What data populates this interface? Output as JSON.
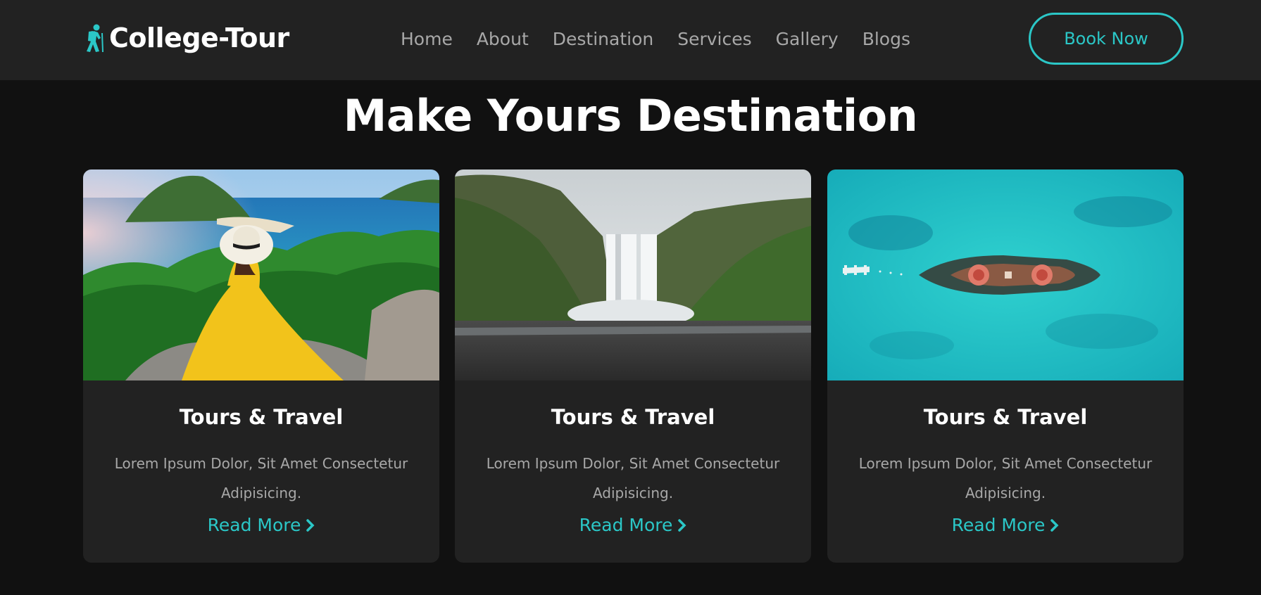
{
  "header": {
    "logo_text": "College-Tour",
    "logo_icon": "hiker-icon",
    "nav": [
      "Home",
      "About",
      "Destination",
      "Services",
      "Gallery",
      "Blogs"
    ],
    "cta_label": "Book Now"
  },
  "section": {
    "title": "Make Yours Destination"
  },
  "cards": [
    {
      "title": "Tours & Travel",
      "text": "Lorem Ipsum Dolor, Sit Amet Consectetur Adipisicing.",
      "link": "Read More"
    },
    {
      "title": "Tours & Travel",
      "text": "Lorem Ipsum Dolor, Sit Amet Consectetur Adipisicing.",
      "link": "Read More"
    },
    {
      "title": "Tours & Travel",
      "text": "Lorem Ipsum Dolor, Sit Amet Consectetur Adipisicing.",
      "link": "Read More"
    }
  ],
  "colors": {
    "accent": "#2bc7c7",
    "header_bg": "#222222",
    "page_bg": "#111111",
    "card_bg": "#222222",
    "muted_text": "#a8a8a8"
  }
}
